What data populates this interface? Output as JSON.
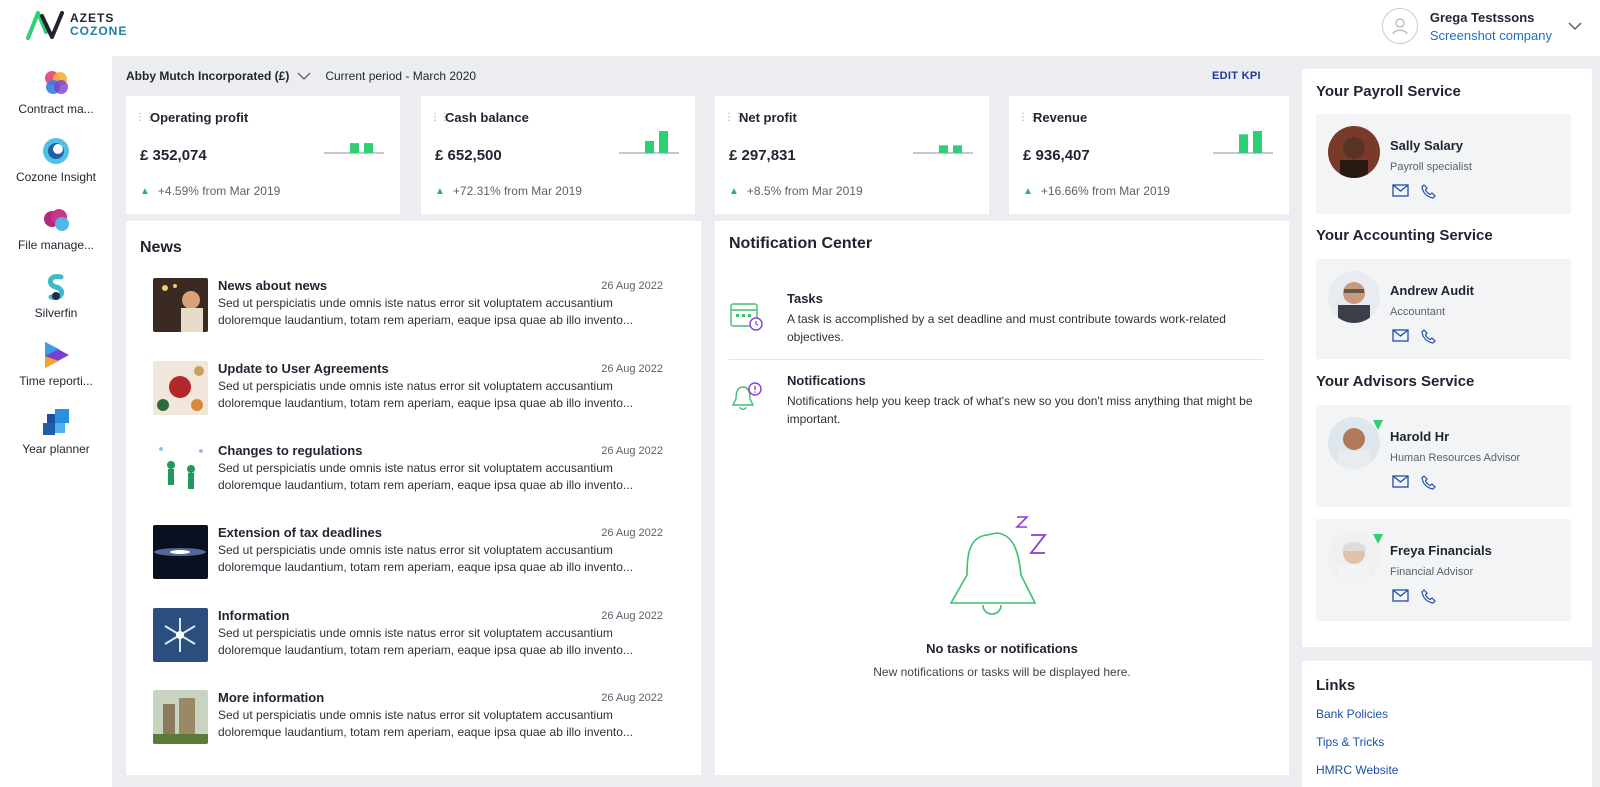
{
  "brand": {
    "line1": "AZETS",
    "line2": "COZONE"
  },
  "user": {
    "name": "Grega Testssons",
    "company": "Screenshot company"
  },
  "sidebar": {
    "items": [
      {
        "label": "Contract ma...",
        "icon": "contract-management-icon"
      },
      {
        "label": "Cozone Insight",
        "icon": "cozone-insight-icon"
      },
      {
        "label": "File manage...",
        "icon": "file-manager-icon"
      },
      {
        "label": "Silverfin",
        "icon": "silverfin-icon"
      },
      {
        "label": "Time reporti...",
        "icon": "time-reporting-icon"
      },
      {
        "label": "Year planner",
        "icon": "year-planner-icon"
      }
    ]
  },
  "header": {
    "company": "Abby Mutch Incorporated (£)",
    "period": "Current period - March 2020",
    "edit_kpi": "EDIT KPI"
  },
  "kpis": [
    {
      "title": "Operating profit",
      "value": "£ 352,074",
      "change": "+4.59% from Mar 2019",
      "bars": [
        0.45,
        0.45
      ]
    },
    {
      "title": "Cash balance",
      "value": "£ 652,500",
      "change": "+72.31% from Mar 2019",
      "bars": [
        0.55,
        1.0
      ]
    },
    {
      "title": "Net profit",
      "value": "£ 297,831",
      "change": "+8.5% from Mar 2019",
      "bars": [
        0.35,
        0.35
      ]
    },
    {
      "title": "Revenue",
      "value": "£ 936,407",
      "change": "+16.66% from Mar 2019",
      "bars": [
        0.85,
        1.0
      ]
    }
  ],
  "news": {
    "title": "News",
    "items": [
      {
        "title": "News about news",
        "date": "26 Aug 2022",
        "body": "Sed ut perspiciatis unde omnis iste natus error sit voluptatem accusantium doloremque laudantium, totam rem aperiam, eaque ipsa quae ab illo invento..."
      },
      {
        "title": "Update to User Agreements",
        "date": "26 Aug 2022",
        "body": "Sed ut perspiciatis unde omnis iste natus error sit voluptatem accusantium doloremque laudantium, totam rem aperiam, eaque ipsa quae ab illo invento..."
      },
      {
        "title": "Changes to regulations",
        "date": "26 Aug 2022",
        "body": "Sed ut perspiciatis unde omnis iste natus error sit voluptatem accusantium doloremque laudantium, totam rem aperiam, eaque ipsa quae ab illo invento..."
      },
      {
        "title": "Extension of tax deadlines",
        "date": "26 Aug 2022",
        "body": "Sed ut perspiciatis unde omnis iste natus error sit voluptatem accusantium doloremque laudantium, totam rem aperiam, eaque ipsa quae ab illo invento..."
      },
      {
        "title": "Information",
        "date": "26 Aug 2022",
        "body": "Sed ut perspiciatis unde omnis iste natus error sit voluptatem accusantium doloremque laudantium, totam rem aperiam, eaque ipsa quae ab illo invento..."
      },
      {
        "title": "More information",
        "date": "26 Aug 2022",
        "body": "Sed ut perspiciatis unde omnis iste natus error sit voluptatem accusantium doloremque laudantium, totam rem aperiam, eaque ipsa quae ab illo invento..."
      }
    ]
  },
  "notifications": {
    "title": "Notification Center",
    "tasks": {
      "title": "Tasks",
      "text": "A task is accomplished by a set deadline and must contribute towards work-related objectives."
    },
    "notifs": {
      "title": "Notifications",
      "text": "Notifications help you keep track of what's new so you don't miss anything that might be important."
    },
    "empty_title": "No tasks or notifications",
    "empty_text": "New notifications or tasks will be displayed here."
  },
  "services": {
    "payroll": {
      "title": "Your Payroll Service",
      "name": "Sally Salary",
      "role": "Payroll specialist"
    },
    "accounting": {
      "title": "Your Accounting Service",
      "name": "Andrew Audit",
      "role": "Accountant"
    },
    "advisors": {
      "title": "Your Advisors Service",
      "people": [
        {
          "name": "Harold Hr",
          "role": "Human Resources Advisor"
        },
        {
          "name": "Freya Financials",
          "role": "Financial Advisor"
        }
      ]
    }
  },
  "links": {
    "title": "Links",
    "items": [
      "Bank Policies",
      "Tips & Tricks",
      "HMRC Website"
    ]
  },
  "colors": {
    "accent_green": "#2fcf74",
    "link_blue": "#1f4fa8",
    "notif_green": "#3fbf73",
    "notif_purple": "#8a3fd0"
  }
}
